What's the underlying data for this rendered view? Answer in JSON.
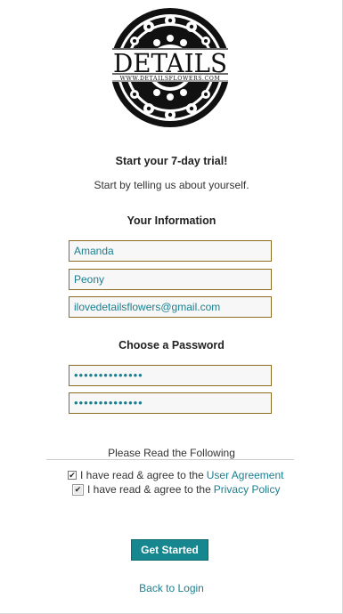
{
  "logo": {
    "brand": "DETAILS",
    "url": "WWW.DETAILSFLOWERS.COM"
  },
  "intro": {
    "title": "Start your 7-day trial!",
    "subtitle": "Start by telling us about yourself."
  },
  "info_section": {
    "heading": "Your Information",
    "first_name": "Amanda",
    "last_name": "Peony",
    "email": "ilovedetailsflowers@gmail.com"
  },
  "password_section": {
    "heading": "Choose a Password",
    "password": "••••••••••••••",
    "confirm": "••••••••••••••"
  },
  "agreements": {
    "heading": "Please Read the Following",
    "user_agreement_text": "I have read & agree to the",
    "user_agreement_link": "User Agreement",
    "privacy_text": "I have read & agree to the",
    "privacy_link": "Privacy Policy",
    "checkmark": "✔"
  },
  "actions": {
    "submit_label": "Get Started",
    "back_label": "Back to Login"
  },
  "colors": {
    "accent": "#16868f",
    "link": "#1b7f8f",
    "field_border": "#8a6d1e"
  }
}
